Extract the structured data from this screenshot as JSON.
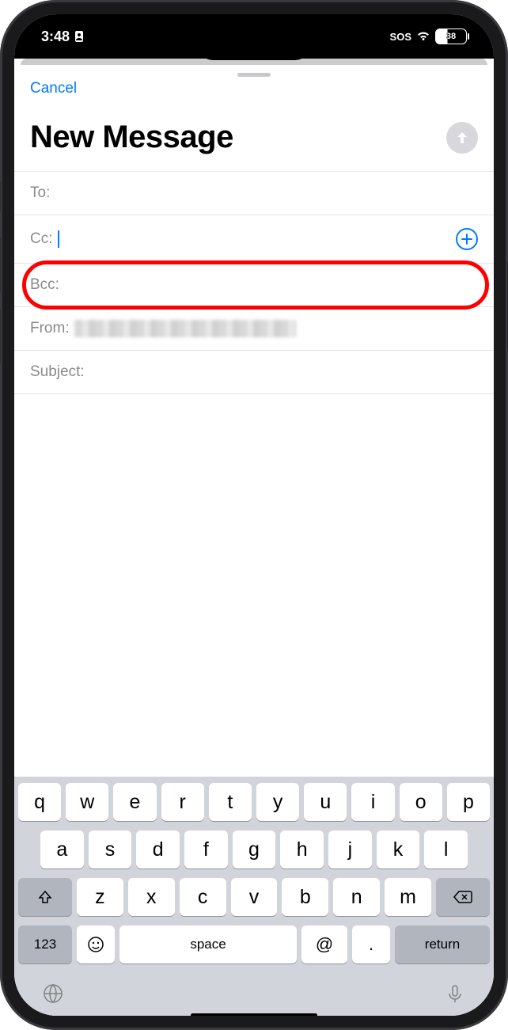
{
  "statusBar": {
    "time": "3:48",
    "sos": "SOS",
    "battery": "38"
  },
  "sheet": {
    "cancel": "Cancel",
    "title": "New Message",
    "fields": {
      "to": "To:",
      "cc": "Cc:",
      "bcc": "Bcc:",
      "from": "From:",
      "subject": "Subject:"
    }
  },
  "keyboard": {
    "row1": [
      "q",
      "w",
      "e",
      "r",
      "t",
      "y",
      "u",
      "i",
      "o",
      "p"
    ],
    "row2": [
      "a",
      "s",
      "d",
      "f",
      "g",
      "h",
      "j",
      "k",
      "l"
    ],
    "row3": [
      "z",
      "x",
      "c",
      "v",
      "b",
      "n",
      "m"
    ],
    "numKey": "123",
    "space": "space",
    "at": "@",
    "dot": ".",
    "return": "return"
  }
}
